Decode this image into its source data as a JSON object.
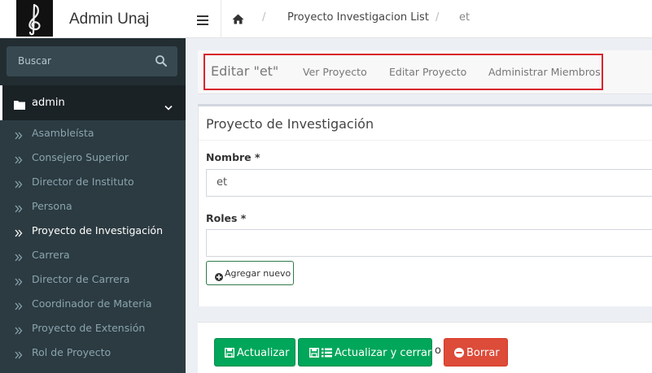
{
  "brand": {
    "title": "Admin Unaj",
    "logo_icon": "treble-clef-icon"
  },
  "search": {
    "placeholder": "Buscar"
  },
  "menu": {
    "header": "admin",
    "items": [
      {
        "label": "Asambleísta",
        "active": false
      },
      {
        "label": "Consejero Superior",
        "active": false
      },
      {
        "label": "Director de Instituto",
        "active": false
      },
      {
        "label": "Persona",
        "active": false
      },
      {
        "label": "Proyecto de Investigación",
        "active": true
      },
      {
        "label": "Carrera",
        "active": false
      },
      {
        "label": "Director de Carrera",
        "active": false
      },
      {
        "label": "Coordinador de Materia",
        "active": false
      },
      {
        "label": "Proyecto de Extensión",
        "active": false
      },
      {
        "label": "Rol de Proyecto",
        "active": false
      }
    ]
  },
  "breadcrumb": {
    "separator": "/",
    "list": "Proyecto Investigacion List",
    "current": "et"
  },
  "tabs": {
    "title": "Editar \"et\"",
    "items": [
      "Ver Proyecto",
      "Editar Proyecto",
      "Administrar Miembros"
    ]
  },
  "form": {
    "title": "Proyecto de Investigación",
    "nombre_label": "Nombre *",
    "nombre_value": "et",
    "roles_label": "Roles *",
    "roles_value": "",
    "add_label": "Agregar nuevo"
  },
  "actions": {
    "update": "Actualizar",
    "update_close": "Actualizar y cerrar",
    "or": "o",
    "delete": "Borrar"
  },
  "colors": {
    "sidebar": "#222d32",
    "green": "#00a65a",
    "red": "#dd4b39",
    "highlight": "#d9252d"
  }
}
